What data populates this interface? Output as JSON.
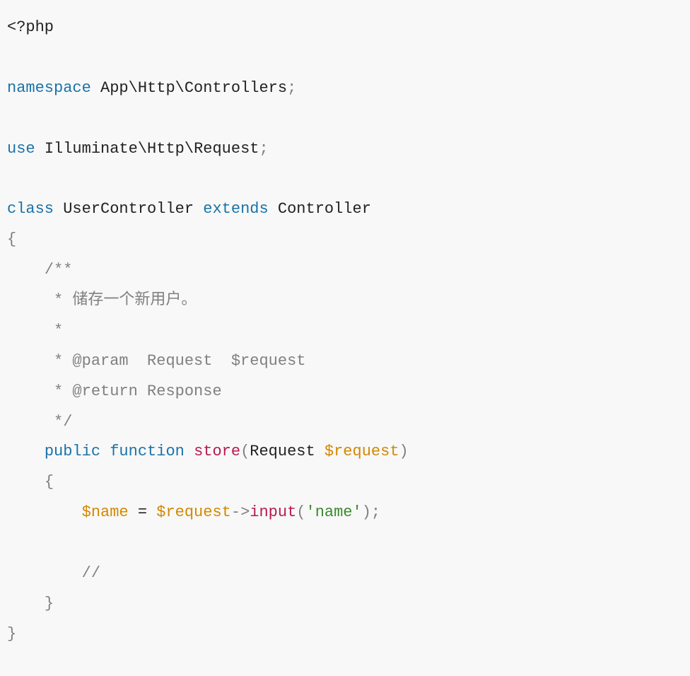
{
  "code": {
    "open_tag": "<?php",
    "namespace_kw": "namespace",
    "namespace_1": "App",
    "namespace_2": "Http",
    "namespace_3": "Controllers",
    "use_kw": "use",
    "use_1": "Illuminate",
    "use_2": "Http",
    "use_3": "Request",
    "class_kw": "class",
    "class_name": "UserController",
    "extends_kw": "extends",
    "parent_name": "Controller",
    "doc_open": "/**",
    "doc_line1": " * 储存一个新用户。",
    "doc_line2": " *",
    "doc_line3": " * @param  Request  $request",
    "doc_line4": " * @return Response",
    "doc_close": " */",
    "public_kw": "public",
    "function_kw": "function",
    "method_name": "store",
    "param_type": "Request",
    "param_var": "$request",
    "var_name": "$name",
    "eq": " = ",
    "req_var": "$request",
    "arrow": "->",
    "input_call": "input",
    "str_name": "'name'",
    "inline_cmt": "//",
    "semi": ";",
    "comma": ",",
    "lparen": "(",
    "rparen": ")",
    "lbrace": "{",
    "rbrace": "}",
    "bslash": "\\"
  }
}
